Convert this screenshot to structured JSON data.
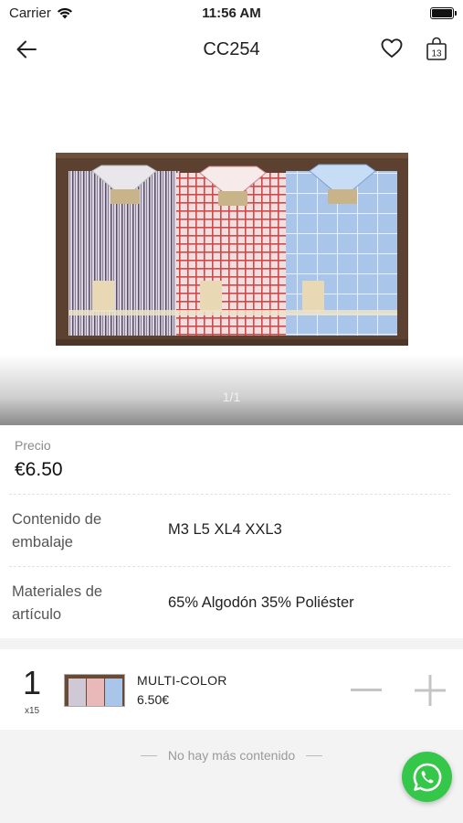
{
  "status": {
    "carrier": "Carrier",
    "time": "11:56 AM"
  },
  "nav": {
    "title": "CC254",
    "cart_count": "13"
  },
  "gallery": {
    "page_indicator": "1/1"
  },
  "product": {
    "price_label": "Precio",
    "price": "€6.50",
    "packing_label": "Contenido de embalaje",
    "packing_value": "M3 L5 XL4 XXL3",
    "materials_label": "Materiales de artículo",
    "materials_value": "65% Algodón  35% Poliéster"
  },
  "variant": {
    "quantity": "1",
    "multiplier": "x15",
    "name": "MULTI-COLOR",
    "price": "6.50€"
  },
  "footer": {
    "no_more": "No hay más contenido"
  },
  "colors": {
    "whatsapp": "#35c74a",
    "photo_bg": "#5c4131"
  }
}
